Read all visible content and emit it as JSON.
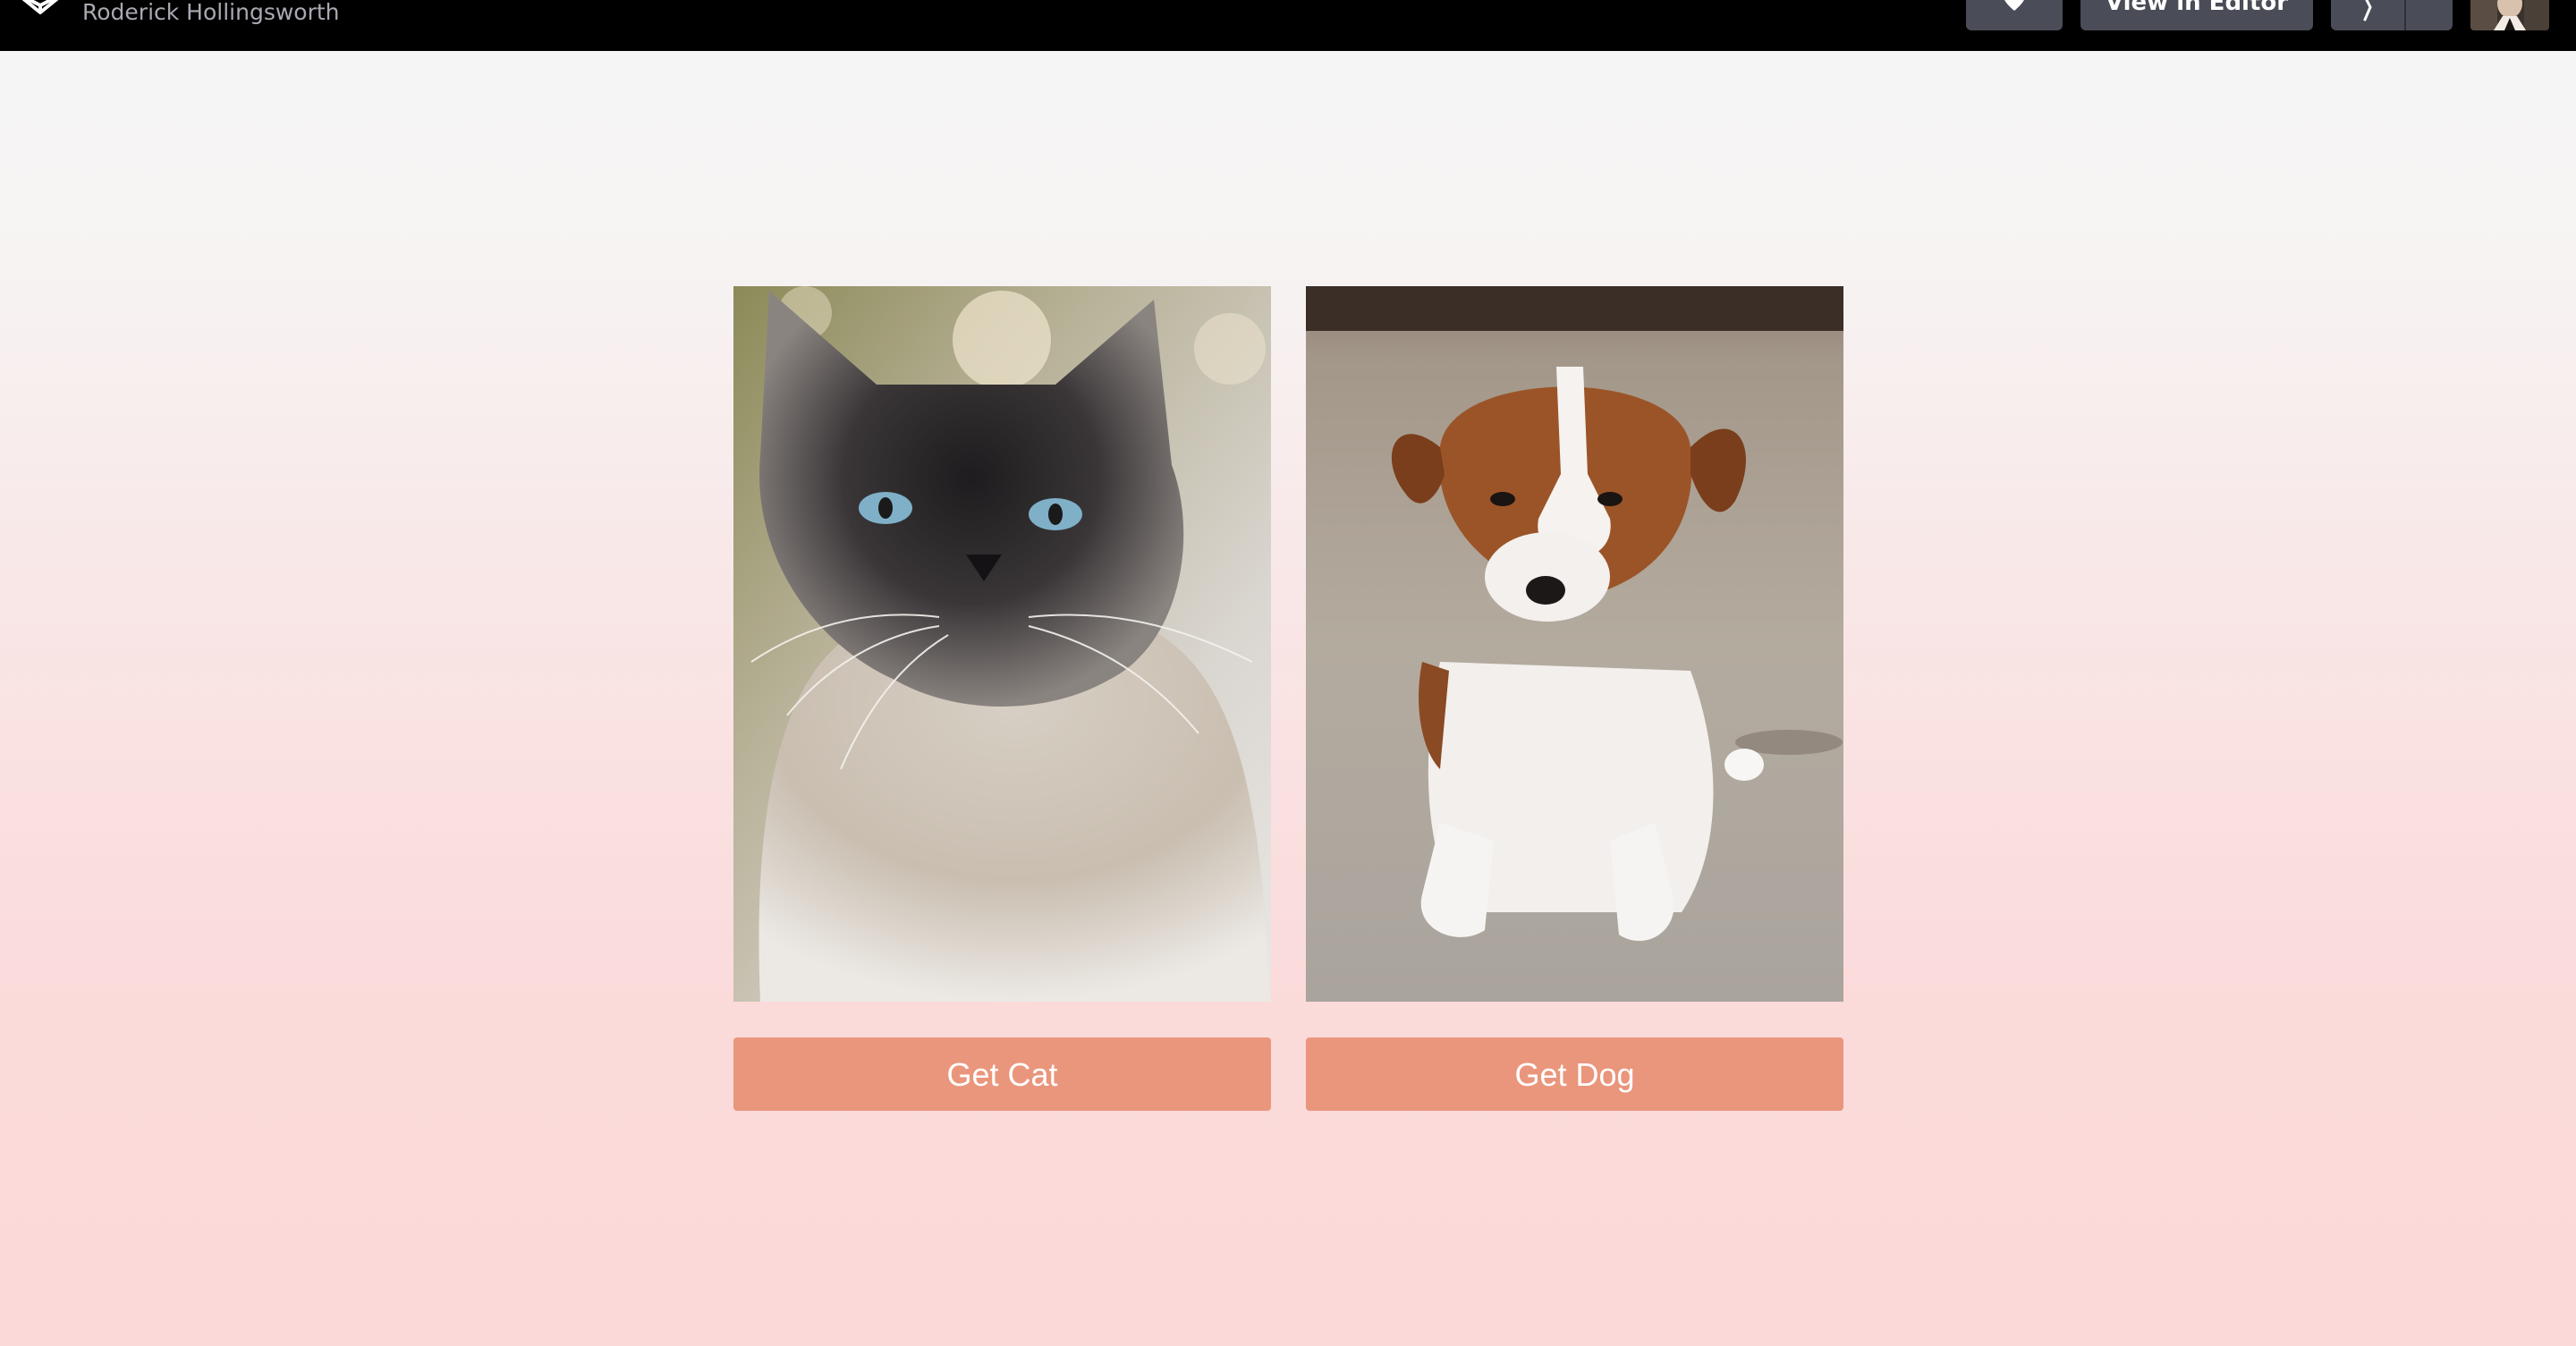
{
  "header": {
    "author_name": "Roderick Hollingsworth",
    "heart_icon": "heart-icon",
    "view_in_editor_label": "View in Editor",
    "fork_icon": "fork-icon",
    "more_icon": "more-icon"
  },
  "main": {
    "cat": {
      "image_subject": "cat-photo",
      "button_label": "Get Cat"
    },
    "dog": {
      "image_subject": "dog-photo",
      "button_label": "Get Dog"
    }
  },
  "colors": {
    "topbar": "#000000",
    "button_accent": "#ea967c",
    "header_button": "#4a4c57",
    "background_top": "#f6f6f6",
    "background_bottom": "#fcd9d9"
  }
}
